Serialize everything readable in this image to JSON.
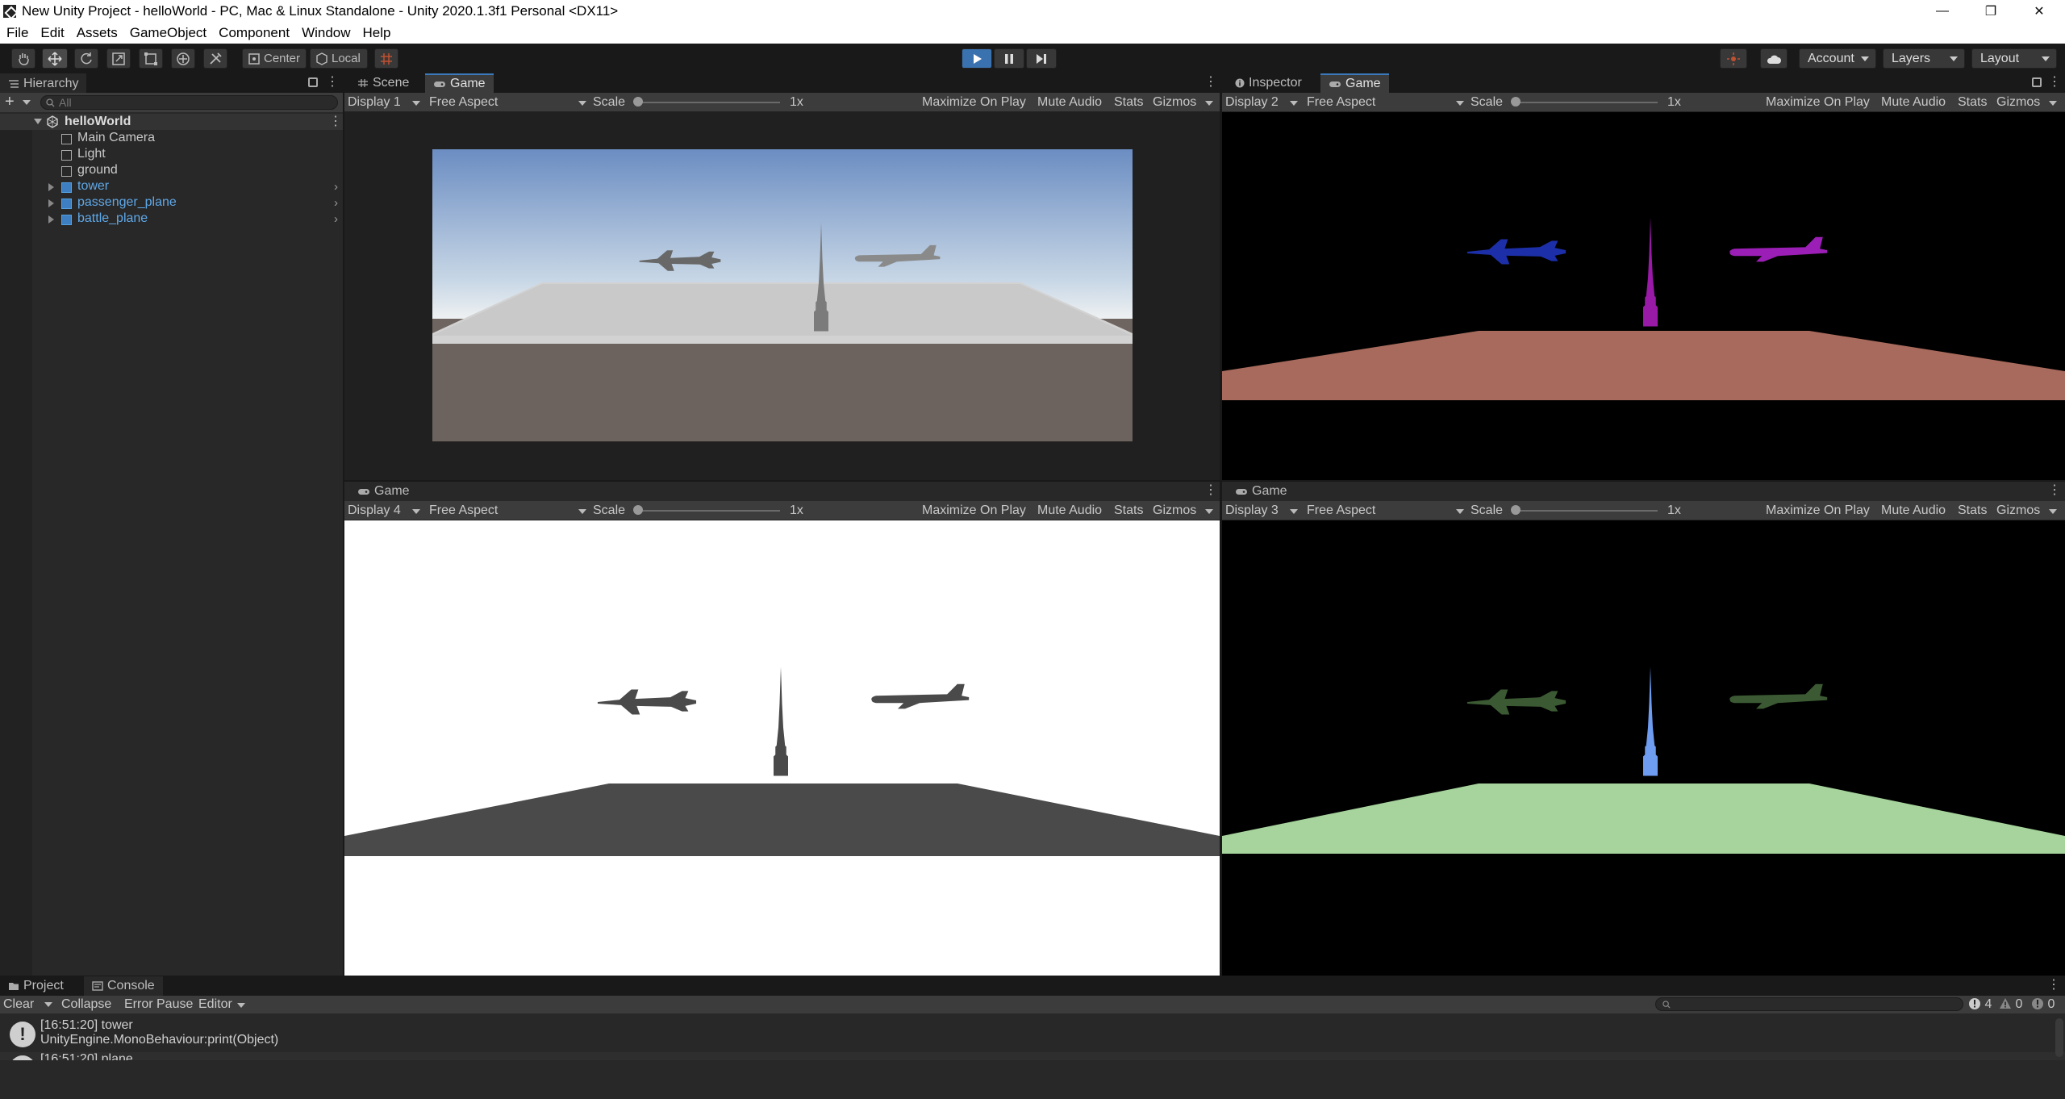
{
  "window": {
    "title": "New Unity Project - helloWorld - PC, Mac & Linux Standalone - Unity 2020.1.3f1 Personal <DX11>",
    "minimize": "—",
    "restore": "❐",
    "close": "✕"
  },
  "menu": [
    "File",
    "Edit",
    "Assets",
    "GameObject",
    "Component",
    "Window",
    "Help"
  ],
  "toolbar": {
    "pivot_label": "Center",
    "space_label": "Local",
    "account_label": "Account",
    "layers_label": "Layers",
    "layout_label": "Layout"
  },
  "hierarchy": {
    "tab_label": "Hierarchy",
    "add_label": "+",
    "search_placeholder": "All",
    "scene_name": "helloWorld",
    "items": [
      {
        "label": "Main Camera",
        "prefab": false
      },
      {
        "label": "Light",
        "prefab": false
      },
      {
        "label": "ground",
        "prefab": false
      },
      {
        "label": "tower",
        "prefab": true
      },
      {
        "label": "passenger_plane",
        "prefab": true
      },
      {
        "label": "battle_plane",
        "prefab": true
      }
    ]
  },
  "game_bar": {
    "aspect": "Free Aspect",
    "scale_label": "Scale",
    "scale_value": "1x",
    "maximize": "Maximize On Play",
    "mute": "Mute Audio",
    "stats": "Stats",
    "gizmos": "Gizmos"
  },
  "views": {
    "top_left": {
      "tabs": [
        "Scene",
        "Game"
      ],
      "display": "Display 1"
    },
    "top_right": {
      "tabs": [
        "Inspector",
        "Game"
      ],
      "display": "Display 2"
    },
    "bottom_left": {
      "tabs": [
        "Game"
      ],
      "display": "Display 4"
    },
    "bottom_right": {
      "tabs": [
        "Game"
      ],
      "display": "Display 3"
    }
  },
  "console": {
    "tabs": [
      "Project",
      "Console"
    ],
    "clear": "Clear",
    "collapse": "Collapse",
    "error_pause": "Error Pause",
    "editor": "Editor",
    "count_log": "4",
    "count_warn": "0",
    "count_error": "0",
    "entries": [
      {
        "line1": "[16:51:20] tower",
        "line2": "UnityEngine.MonoBehaviour:print(Object)"
      },
      {
        "line1": "[16:51:20] plane",
        "line2": ""
      }
    ]
  },
  "colors": {
    "accent": "#3a79bb",
    "prefab_text": "#5fa8e8",
    "display2_ground": "#a86a5c",
    "display2_fighter": "#1c2fa8",
    "display2_airliner": "#9b1fb6",
    "display2_tower": "#9a1aa8",
    "display3_ground": "#a6d49c",
    "display3_planes": "#3b5a33",
    "display3_tower": "#6d9cf0",
    "display4_silhouette": "#4a4a4a"
  }
}
